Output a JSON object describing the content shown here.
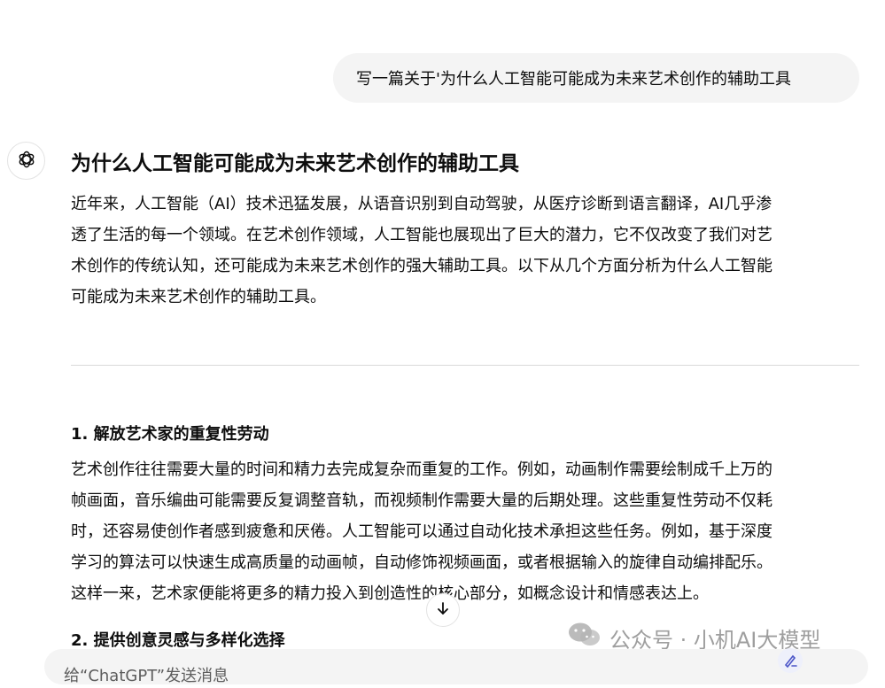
{
  "user_message": "写一篇关于'为什么人工智能可能成为未来艺术创作的辅助工具",
  "answer": {
    "title": "为什么人工智能可能成为未来艺术创作的辅助工具",
    "intro_lines": [
      "近年来，人工智能（AI）技术迅猛发展，从语音识别到自动驾驶，从医疗诊断到语言翻译，AI几乎渗",
      "透了生活的每一个领域。在艺术创作领域，人工智能也展现出了巨大的潜力，它不仅改变了我们对艺",
      "术创作的传统认知，还可能成为未来艺术创作的强大辅助工具。以下从几个方面分析为什么人工智能",
      "可能成为未来艺术创作的辅助工具。"
    ],
    "section1": {
      "heading": "1. 解放艺术家的重复性劳动",
      "lines": [
        "艺术创作往往需要大量的时间和精力去完成复杂而重复的工作。例如，动画制作需要绘制成千上万的",
        "帧画面，音乐编曲可能需要反复调整音轨，而视频制作需要大量的后期处理。这些重复性劳动不仅耗",
        "时，还容易使创作者感到疲惫和厌倦。人工智能可以通过自动化技术承担这些任务。例如，基于深度",
        "学习的算法可以快速生成高质量的动画帧，自动修饰视频画面，或者根据输入的旋律自动编排配乐。",
        "这样一来，艺术家便能将更多的精力投入到创造性的核心部分，如概念设计和情感表达上。"
      ]
    },
    "section2": {
      "heading": "2. 提供创意灵感与多样化选择"
    }
  },
  "composer": {
    "placeholder": "给“ChatGPT”发送消息"
  },
  "watermark": {
    "text": "公众号 · 小机AI大模型"
  },
  "icons": {
    "avatar": "openai-logo-icon",
    "scroll": "arrow-down-icon",
    "watermark": "wechat-icon",
    "pen": "pen-icon"
  }
}
